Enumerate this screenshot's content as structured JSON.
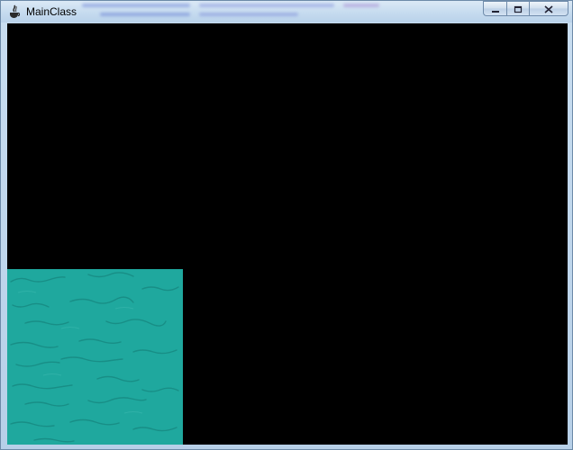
{
  "window": {
    "title": "MainClass",
    "icons": {
      "app": "java-app-icon",
      "minimize": "minimize-icon",
      "maximize": "maximize-icon",
      "close": "close-icon"
    }
  },
  "canvas": {
    "background": "#000000",
    "tile": {
      "texture": "water",
      "color": "#1fa89e"
    }
  }
}
